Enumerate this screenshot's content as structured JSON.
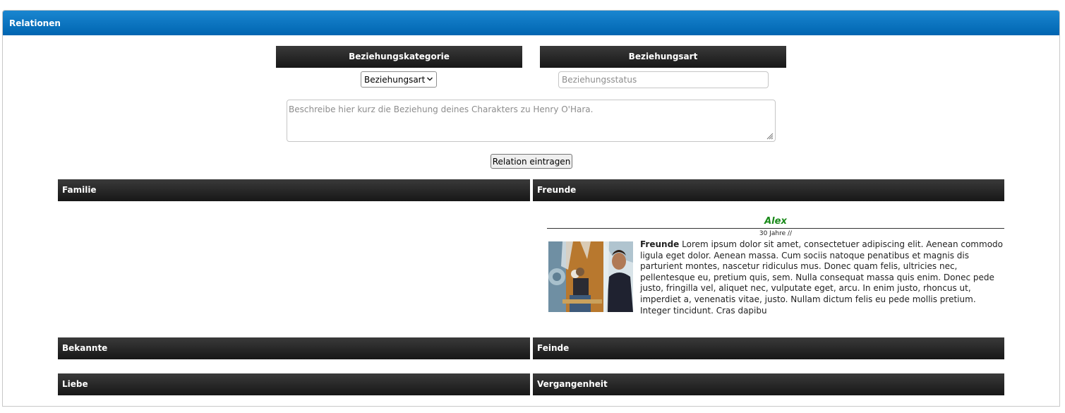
{
  "panel": {
    "title": "Relationen"
  },
  "form": {
    "category_header": "Beziehungskategorie",
    "type_header": "Beziehungsart",
    "select_value": "Beziehungsart",
    "status_placeholder": "Beziehungsstatus",
    "description_placeholder": "Beschreibe hier kurz die Beziehung deines Charakters zu Henry O'Hara.",
    "submit_label": "Relation eintragen"
  },
  "sections": {
    "familie": "Familie",
    "freunde": "Freunde",
    "bekannte": "Bekannte",
    "feinde": "Feinde",
    "liebe": "Liebe",
    "vergangenheit": "Vergangenheit"
  },
  "relations": [
    {
      "name": "Alex",
      "age": "30 Jahre //",
      "category": "Freunde",
      "text": " Lorem ipsum dolor sit amet, consectetuer adipiscing elit. Aenean commodo ligula eget dolor. Aenean massa. Cum sociis natoque penatibus et magnis dis parturient montes, nascetur ridiculus mus. Donec quam felis, ultricies nec, pellentesque eu, pretium quis, sem. Nulla consequat massa quis enim. Donec pede justo, fringilla vel, aliquet nec, vulputate eget, arcu. In enim justo, rhoncus ut, imperdiet a, venenatis vitae, justo. Nullam dictum felis eu pede mollis pretium. Integer tincidunt. Cras dapibu"
    }
  ],
  "colors": {
    "header_blue": "#0a73c1",
    "bar_dark": "#1f1f1f",
    "name_green": "#1a8a1a"
  },
  "icons": {
    "select_arrow": "chevron-down-icon",
    "resize_grip": "resize-grip-icon"
  }
}
